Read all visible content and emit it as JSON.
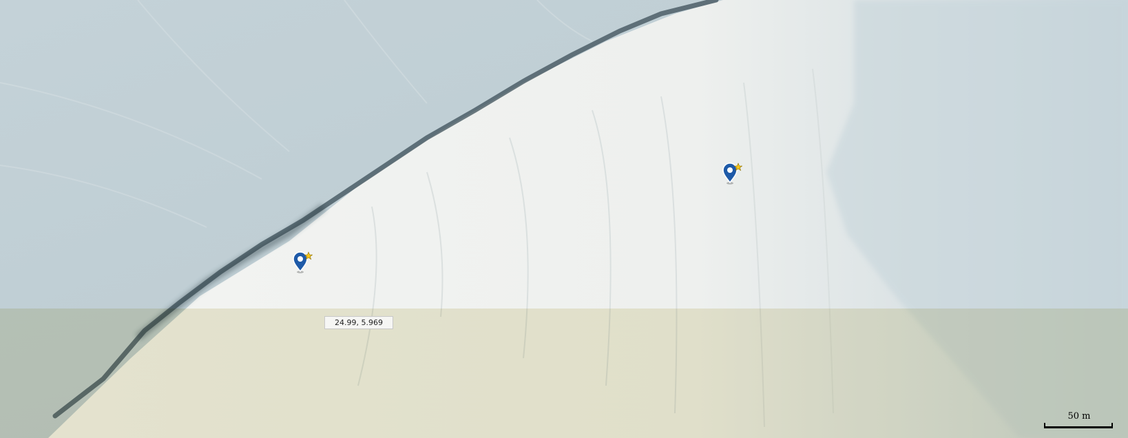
{
  "map": {
    "type": "satellite",
    "markers": [
      {
        "icon": "location-pin-star-icon",
        "color": "#1e5aa8",
        "badge_color": "#f5c518"
      },
      {
        "icon": "location-pin-star-icon",
        "color": "#1e5aa8",
        "badge_color": "#f5c518"
      }
    ],
    "coordinate_readout": "24.99, 5.969",
    "scale_label": "50 m"
  }
}
